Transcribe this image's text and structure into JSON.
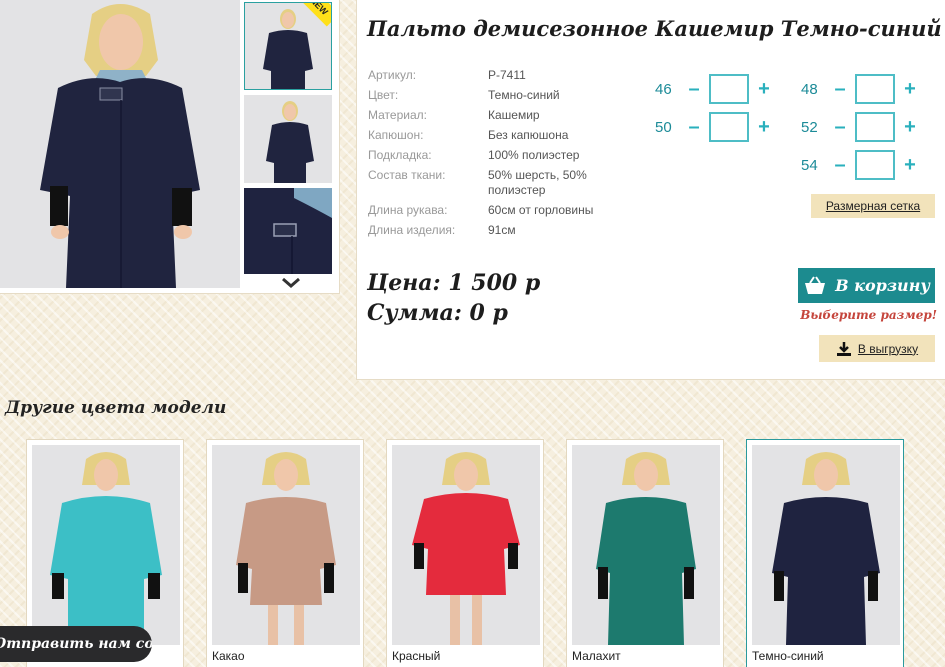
{
  "product": {
    "title": "Пальто демисезонное Кашемир Темно-синий",
    "specs": [
      {
        "label": "Артикул:",
        "value": "Р-7411"
      },
      {
        "label": "Цвет:",
        "value": "Темно-синий"
      },
      {
        "label": "Материал:",
        "value": "Кашемир"
      },
      {
        "label": "Капюшон:",
        "value": "Без капюшона"
      },
      {
        "label": "Подкладка:",
        "value": "100% полиэстер"
      },
      {
        "label": "Состав ткани:",
        "value": "50% шерсть, 50% полиэстер"
      },
      {
        "label": "Длина рукава:",
        "value": "60см от горловины"
      },
      {
        "label": "Длина изделия:",
        "value": "91см"
      }
    ],
    "price_line": "Цена: 1 500 р",
    "sum_line": "Сумма: 0 р",
    "badge": "NEW"
  },
  "sizes": {
    "items": [
      {
        "size": "46",
        "qty": ""
      },
      {
        "size": "48",
        "qty": ""
      },
      {
        "size": "50",
        "qty": ""
      },
      {
        "size": "52",
        "qty": ""
      },
      {
        "size": "54",
        "qty": ""
      }
    ],
    "minus": "–",
    "plus": "+",
    "size_chart_label": "Размерная сетка"
  },
  "actions": {
    "cart_label": "В корзину",
    "size_warning": "Выберите размер!",
    "export_label": "В выгрузку"
  },
  "other_colors": {
    "title": "Другие цвета модели",
    "items": [
      {
        "label": "",
        "color": "#3cbfc6"
      },
      {
        "label": "Какао",
        "color": "#c79a85"
      },
      {
        "label": "Красный",
        "color": "#e42b3d"
      },
      {
        "label": "Малахит",
        "color": "#1d7a6e"
      },
      {
        "label": "Темно-синий",
        "color": "#1f2340"
      }
    ]
  },
  "message_tab": "Отправить нам сообщение",
  "colors": {
    "accent": "#1c8b8f",
    "size_number": "#1c8b98",
    "warning": "#c5453c",
    "button_beige": "#f2e3bb",
    "coat_navy": "#1f2340"
  }
}
